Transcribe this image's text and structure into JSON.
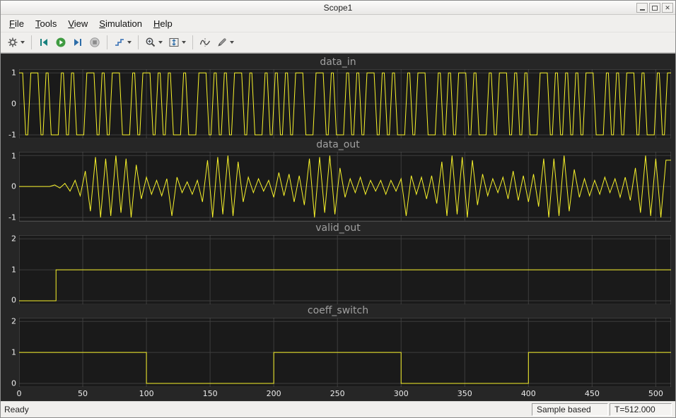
{
  "window": {
    "title": "Scope1"
  },
  "menubar": {
    "items": [
      "File",
      "Tools",
      "View",
      "Simulation",
      "Help"
    ]
  },
  "toolbar": {
    "icons": [
      "gear-icon",
      "step-back-icon",
      "run-icon",
      "step-forward-icon",
      "stop-icon",
      "stepping-options-icon",
      "zoom-icon",
      "scale-axes-icon",
      "cursor-measurements-icon",
      "measurements-icon"
    ]
  },
  "statusbar": {
    "status": "Ready",
    "mode": "Sample based",
    "time": "T=512.000"
  },
  "scope": {
    "x_ticks": [
      0,
      50,
      100,
      150,
      200,
      250,
      300,
      350,
      400,
      450,
      500
    ],
    "x_max": 512,
    "colors": {
      "signal": "#f8f32b",
      "canvas_background": "#262626",
      "axes_background": "#1a1a1a",
      "grid": "#3d3d3d",
      "axes_border": "#5a5a5a",
      "title": "#a0a0a0",
      "tick_label": "#ececec"
    }
  },
  "chart_data": [
    {
      "type": "line",
      "title": "data_in",
      "x_range": [
        0,
        512
      ],
      "ylim": [
        -1.12,
        1.12
      ],
      "yticks": [
        1,
        0,
        -1
      ],
      "bit_width": 4,
      "bits": [
        1,
        -1,
        1,
        1,
        -1,
        1,
        -1,
        -1,
        1,
        -1,
        1,
        -1,
        -1,
        1,
        1,
        -1,
        1,
        -1,
        1,
        1,
        -1,
        -1,
        1,
        -1,
        1,
        1,
        -1,
        1,
        -1,
        1,
        -1,
        -1,
        1,
        -1,
        -1,
        1,
        1,
        -1,
        1,
        -1,
        1,
        -1,
        1,
        1,
        -1,
        1,
        -1,
        -1,
        1,
        -1,
        1,
        -1,
        1,
        -1,
        1,
        1,
        -1,
        -1,
        1,
        1,
        -1,
        1,
        -1,
        -1,
        1,
        -1,
        1,
        -1,
        1,
        1,
        -1,
        1,
        -1,
        1,
        -1,
        -1,
        1,
        -1,
        1,
        1,
        -1,
        -1,
        1,
        -1,
        1,
        -1,
        1,
        1,
        -1,
        1,
        -1,
        -1,
        1,
        -1,
        1,
        1,
        -1,
        1,
        -1,
        1,
        -1,
        -1,
        1,
        1,
        -1,
        1,
        -1,
        1,
        -1,
        1,
        -1,
        1,
        1,
        -1,
        -1,
        1,
        -1,
        1,
        -1,
        1,
        1,
        -1,
        1,
        -1,
        -1,
        1,
        -1,
        1
      ]
    },
    {
      "type": "line",
      "title": "data_out",
      "x_range": [
        0,
        512
      ],
      "ylim": [
        -1.12,
        1.12
      ],
      "yticks": [
        1,
        0,
        -1
      ],
      "x_step": 4,
      "values": [
        0,
        0,
        0,
        0,
        0,
        0,
        0,
        0.05,
        -0.05,
        0.1,
        -0.15,
        0.2,
        -0.3,
        0.5,
        -0.8,
        0.95,
        -1,
        0.9,
        -0.95,
        1,
        -0.85,
        0.9,
        -1,
        0.7,
        -0.4,
        0.3,
        -0.25,
        0.2,
        -0.3,
        0.25,
        -0.95,
        0.3,
        -0.2,
        0.15,
        -0.25,
        0.2,
        -0.5,
        0.85,
        -1,
        0.95,
        -0.9,
        1,
        -0.95,
        0.8,
        -0.5,
        0.3,
        -0.2,
        0.25,
        -0.15,
        0.2,
        -0.35,
        0.45,
        -0.3,
        0.4,
        -0.5,
        0.35,
        -0.6,
        0.9,
        -1,
        0.95,
        -0.85,
        1,
        -0.9,
        0.6,
        -0.35,
        0.25,
        -0.2,
        0.3,
        -0.25,
        0.2,
        -0.15,
        0.2,
        -0.25,
        0.2,
        -0.15,
        0.25,
        -0.95,
        0.35,
        -0.25,
        0.3,
        -0.4,
        0.35,
        -0.55,
        0.8,
        -0.95,
        1,
        -0.9,
        0.95,
        -1,
        0.85,
        -0.6,
        0.4,
        -0.3,
        0.25,
        -0.2,
        0.3,
        -0.4,
        0.5,
        -0.45,
        0.35,
        -0.5,
        0.4,
        -0.65,
        0.9,
        -1,
        0.9,
        -0.95,
        1,
        -0.8,
        0.55,
        -0.35,
        0.25,
        -0.3,
        0.2,
        -0.25,
        0.3,
        -0.2,
        0.25,
        -0.35,
        0.3,
        -0.45,
        0.6,
        -0.85,
        1,
        -0.95,
        0.9,
        -1,
        0.85
      ]
    },
    {
      "type": "line",
      "title": "valid_out",
      "x_range": [
        0,
        512
      ],
      "ylim": [
        -0.12,
        2.12
      ],
      "yticks": [
        2,
        1,
        0
      ],
      "points": [
        [
          0,
          0
        ],
        [
          29,
          1
        ]
      ]
    },
    {
      "type": "line",
      "title": "coeff_switch",
      "x_range": [
        0,
        512
      ],
      "ylim": [
        -0.12,
        2.12
      ],
      "yticks": [
        2,
        1,
        0
      ],
      "points": [
        [
          0,
          1
        ],
        [
          100,
          0
        ],
        [
          200,
          1
        ],
        [
          300,
          0
        ],
        [
          400,
          1
        ]
      ]
    }
  ]
}
